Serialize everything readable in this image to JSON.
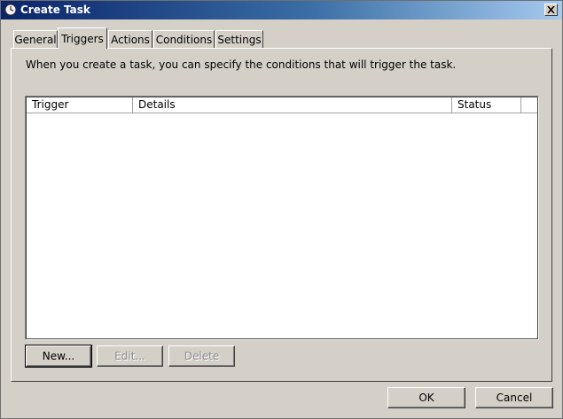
{
  "window": {
    "title": "Create Task",
    "icon": "clock-icon",
    "close_glyph": "✕"
  },
  "tabs": [
    {
      "label": "General",
      "active": false
    },
    {
      "label": "Triggers",
      "active": true
    },
    {
      "label": "Actions",
      "active": false
    },
    {
      "label": "Conditions",
      "active": false
    },
    {
      "label": "Settings",
      "active": false
    }
  ],
  "triggers": {
    "description": "When you create a task, you can specify the conditions that will trigger the task.",
    "columns": [
      "Trigger",
      "Details",
      "Status"
    ],
    "rows": [],
    "buttons": {
      "new": "New...",
      "edit": "Edit...",
      "delete": "Delete"
    }
  },
  "footer": {
    "ok": "OK",
    "cancel": "Cancel"
  },
  "colors": {
    "titlebar_start": "#0a246a",
    "face": "#d4d0c8"
  }
}
